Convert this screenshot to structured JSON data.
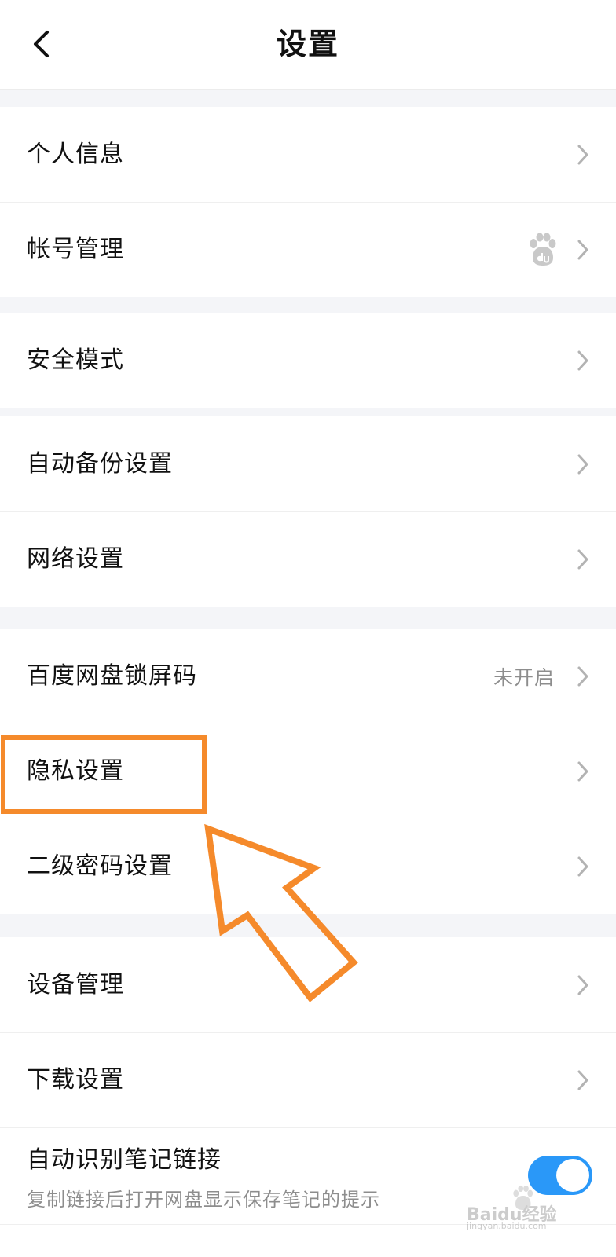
{
  "header": {
    "title": "设置"
  },
  "groups": [
    {
      "items": [
        {
          "label": "个人信息"
        },
        {
          "label": "帐号管理"
        }
      ]
    },
    {
      "items": [
        {
          "label": "安全模式"
        }
      ]
    },
    {
      "items": [
        {
          "label": "自动备份设置"
        },
        {
          "label": "网络设置"
        }
      ]
    },
    {
      "items": [
        {
          "label": "百度网盘锁屏码",
          "value": "未开启"
        },
        {
          "label": "隐私设置"
        },
        {
          "label": "二级密码设置"
        }
      ]
    },
    {
      "items": [
        {
          "label": "设备管理"
        },
        {
          "label": "下载设置"
        },
        {
          "label": "自动识别笔记链接",
          "sublabel": "复制链接后打开网盘显示保存笔记的提示",
          "toggle": true
        }
      ]
    }
  ],
  "watermark": {
    "brand": "Baidu经验",
    "url": "jingyan.baidu.com"
  },
  "colors": {
    "accent": "#2a98f8",
    "annotation": "#f58a2b",
    "chevron": "#b3b3b3",
    "secondary_text": "#8d8d8d",
    "background": "#f4f5f8"
  },
  "icons": {
    "back": "chevron-left-icon",
    "row_arrow": "chevron-right-icon",
    "account": "baidu-paw-icon"
  }
}
